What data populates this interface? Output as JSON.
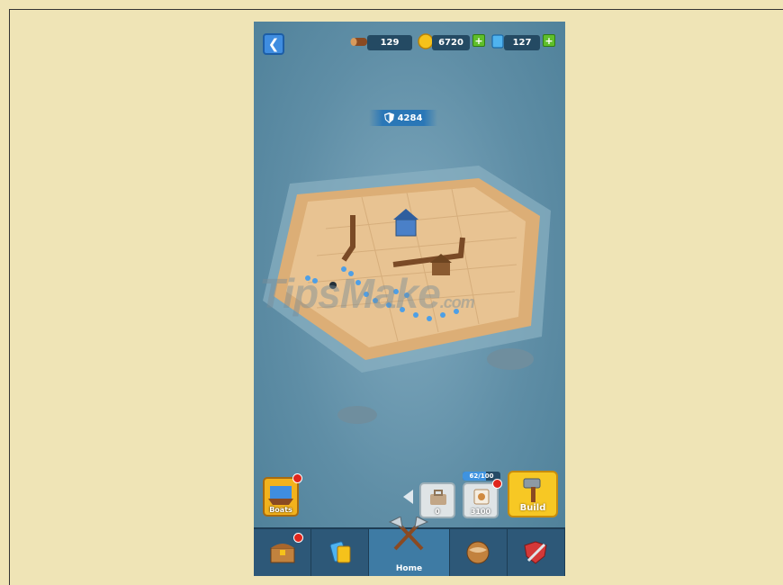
{
  "topbar": {
    "wood_value": "129",
    "gold_value": "6720",
    "gem_value": "127",
    "icons": {
      "back": "chevron-left-icon",
      "wood": "log-icon",
      "gold": "coin-icon",
      "gem": "crystal-icon",
      "add": "plus-icon"
    }
  },
  "shield": {
    "value": "4284",
    "icon": "shield-icon"
  },
  "watermark": {
    "text": "TipsMake",
    "suffix": ".com"
  },
  "boats": {
    "label": "Boats",
    "icon": "ship-icon"
  },
  "slots": [
    {
      "value": "0",
      "icon": "toolbox-icon"
    },
    {
      "value": "3100",
      "icon": "scroll-icon"
    }
  ],
  "capacity": {
    "label": "62/100",
    "fraction": 0.62
  },
  "build": {
    "label": "Build",
    "icon": "hammer-icon"
  },
  "nav": {
    "tabs": [
      {
        "label": "",
        "icon": "treasure-chest-icon"
      },
      {
        "label": "",
        "icon": "cards-icon"
      },
      {
        "label": "Home",
        "icon": "crossed-axes-icon"
      },
      {
        "label": "",
        "icon": "globe-icon"
      },
      {
        "label": "",
        "icon": "shield-sword-icon"
      }
    ]
  },
  "colors": {
    "background": "#efe4b6",
    "sea": "#5f8ea6",
    "accent_yellow": "#f7c824",
    "nav": "#2d5878",
    "alert_red": "#e0261c"
  }
}
